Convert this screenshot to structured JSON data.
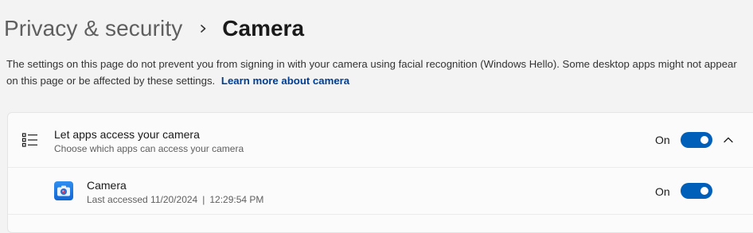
{
  "breadcrumb": {
    "parent": "Privacy & security",
    "current": "Camera"
  },
  "description": {
    "text": "The settings on this page do not prevent you from signing in with your camera using facial recognition (Windows Hello). Some desktop apps might not appear on this page or be affected by these settings.",
    "link": "Learn more about camera"
  },
  "app_access": {
    "title": "Let apps access your camera",
    "subtitle": "Choose which apps can access your camera",
    "state": "On",
    "enabled": true
  },
  "apps": [
    {
      "name": "Camera",
      "last_accessed_label": "Last accessed 11/20/2024",
      "time": "12:29:54 PM",
      "state": "On",
      "enabled": true
    }
  ],
  "colors": {
    "accent": "#005fb8",
    "link": "#003e92",
    "background": "#f3f3f3",
    "card": "#fbfbfb"
  },
  "icons": {
    "separator": "chevron-right-icon",
    "section": "list-icon",
    "collapse": "chevron-up-icon",
    "app": "camera-app-icon"
  }
}
